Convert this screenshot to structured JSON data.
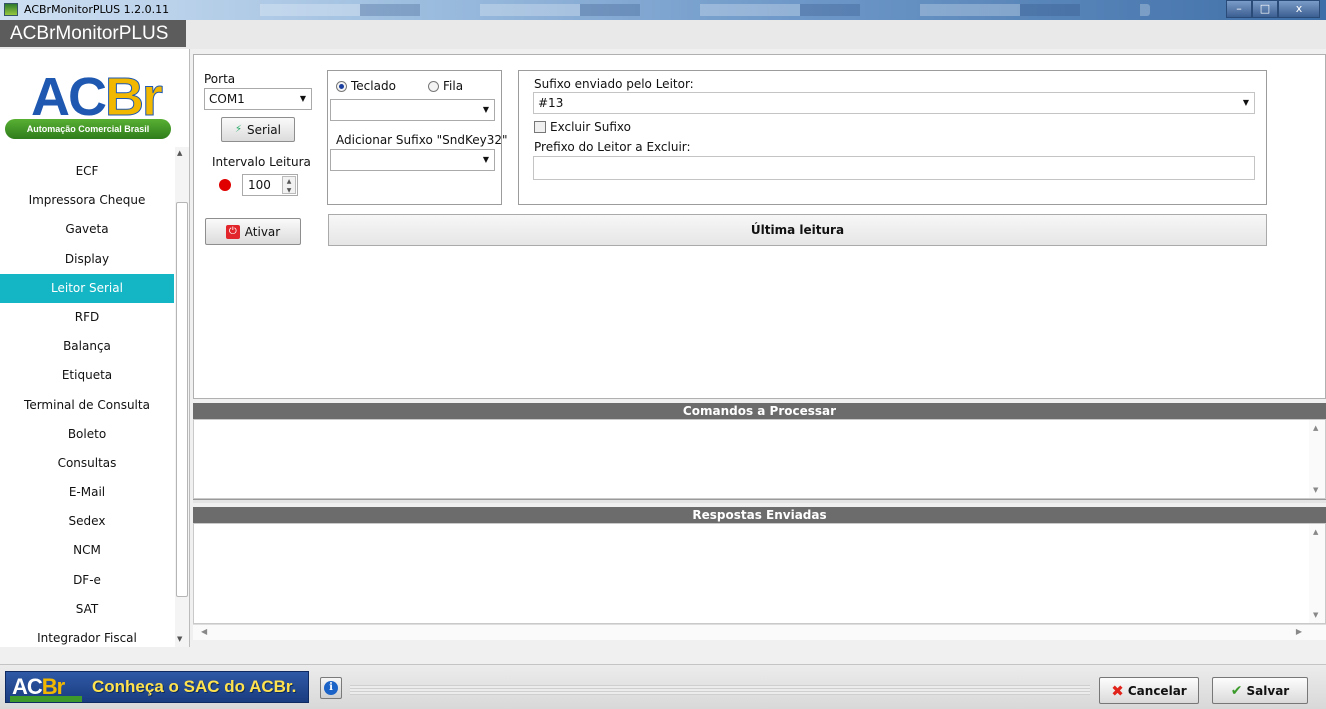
{
  "window": {
    "title": "ACBrMonitorPLUS 1.2.0.11",
    "controls": {
      "minimize": "–",
      "maximize": "□",
      "close": "x"
    }
  },
  "app": {
    "name": "ACBrMonitorPLUS"
  },
  "logo": {
    "letters_a": "AC",
    "letters_b": "Br",
    "tagline": "Automação Comercial Brasil"
  },
  "sidebar": {
    "items": [
      {
        "label": "ECF"
      },
      {
        "label": "Impressora Cheque"
      },
      {
        "label": "Gaveta"
      },
      {
        "label": "Display"
      },
      {
        "label": "Leitor Serial",
        "active": true
      },
      {
        "label": "RFD"
      },
      {
        "label": "Balança"
      },
      {
        "label": "Etiqueta"
      },
      {
        "label": "Terminal de Consulta"
      },
      {
        "label": "Boleto"
      },
      {
        "label": "Consultas"
      },
      {
        "label": "E-Mail"
      },
      {
        "label": "Sedex"
      },
      {
        "label": "NCM"
      },
      {
        "label": "DF-e"
      },
      {
        "label": "SAT"
      },
      {
        "label": "Integrador Fiscal"
      }
    ],
    "accent_color": "#14b5c4"
  },
  "leitor": {
    "porta_label": "Porta",
    "porta_value": "COM1",
    "serial_button": "Serial",
    "intervalo_label": "Intervalo Leitura",
    "intervalo_value": "100",
    "ativar_button": "Ativar",
    "radio_teclado": "Teclado",
    "radio_fila": "Fila",
    "selected_mode": "Teclado",
    "mode_combo_value": "",
    "sufixo_sndkey_label": "Adicionar Sufixo \"SndKey32\"",
    "sufixo_sndkey_value": "",
    "sufixo_leitor_label": "Sufixo enviado pelo Leitor:",
    "sufixo_leitor_value": "#13",
    "excluir_sufixo_label": "Excluir Sufixo",
    "excluir_sufixo_checked": false,
    "prefixo_label": "Prefixo do Leitor a Excluir:",
    "prefixo_value": "",
    "ultima_leitura_label": "Última leitura",
    "status_led_color": "#e00000"
  },
  "panels": {
    "comandos_title": "Comandos a Processar",
    "respostas_title": "Respostas Enviadas"
  },
  "footer": {
    "banner_a": "AC",
    "banner_b": "Br",
    "banner_text": "Conheça o SAC do ACBr.",
    "info_glyph": "i",
    "cancelar_button": "Cancelar",
    "salvar_button": "Salvar"
  }
}
